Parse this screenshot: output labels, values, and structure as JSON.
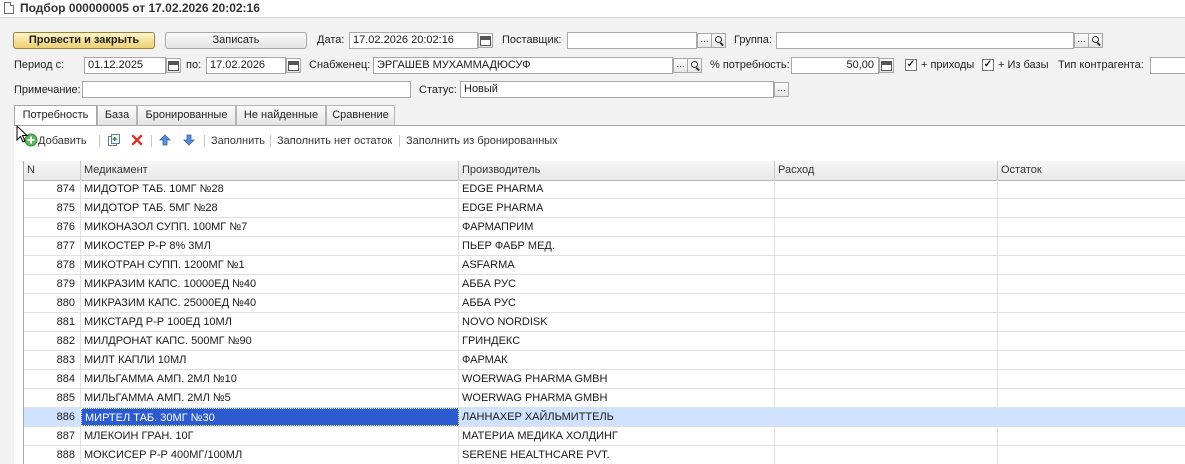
{
  "window": {
    "title": "Подбор 000000005 от 17.02.2026 20:02:16"
  },
  "buttons": {
    "post_close": "Провести и закрыть",
    "save": "Записать"
  },
  "header": {
    "date_label": "Дата:",
    "date_value": "17.02.2026 20:02:16",
    "supplier_label": "Поставщик:",
    "supplier_value": "",
    "group_label": "Группа:",
    "group_value": "",
    "period_label": "Период с:",
    "period_from": "01.12.2025",
    "period_to_label": "по:",
    "period_to": "17.02.2026",
    "procurer_label": "Снабженец:",
    "procurer_value": "ЭРГАШЕВ МУХАММАДЮСУФ",
    "need_pct_label": "% потребность:",
    "need_pct_value": "50,00",
    "incoming_label": "+ приходы",
    "incoming_checked": true,
    "from_base_label": "+ Из базы",
    "from_base_checked": true,
    "contractor_type_label": "Тип контрагента:",
    "note_label": "Примечание:",
    "note_value": "",
    "status_label": "Статус:",
    "status_value": "Новый"
  },
  "tabs": [
    "Потребность",
    "База",
    "Бронированные",
    "Не найденные",
    "Сравнение"
  ],
  "toolbar": {
    "add": "Добавить",
    "fill": "Заполнить",
    "fill_no_stock": "Заполнить нет остаток",
    "fill_from_reserved": "Заполнить из бронированных"
  },
  "table": {
    "columns": [
      "N",
      "Медикамент",
      "Производитель",
      "Расход",
      "Остаток"
    ],
    "rows": [
      {
        "n": "874",
        "drug": "МИДОТОР ТАБ. 10МГ №28",
        "maker": "EDGE PHARMA",
        "usage": "",
        "stock": ""
      },
      {
        "n": "875",
        "drug": "МИДОТОР ТАБ. 5МГ №28",
        "maker": "EDGE PHARMA",
        "usage": "",
        "stock": ""
      },
      {
        "n": "876",
        "drug": "МИКОНАЗОЛ СУПП. 100МГ №7",
        "maker": "ФАРМАПРИМ",
        "usage": "",
        "stock": ""
      },
      {
        "n": "877",
        "drug": "МИКОСТЕР Р-Р 8% 3МЛ",
        "maker": "ПЬЕР ФАБР МЕД.",
        "usage": "",
        "stock": ""
      },
      {
        "n": "878",
        "drug": "МИКОТРАН СУПП. 1200МГ №1",
        "maker": "ASFARMA",
        "usage": "",
        "stock": ""
      },
      {
        "n": "879",
        "drug": "МИКРАЗИМ КАПС. 10000ЕД №40",
        "maker": "АББА РУС",
        "usage": "",
        "stock": ""
      },
      {
        "n": "880",
        "drug": "МИКРАЗИМ КАПС. 25000ЕД №40",
        "maker": "АББА РУС",
        "usage": "",
        "stock": ""
      },
      {
        "n": "881",
        "drug": "МИКСТАРД Р-Р 100ЕД 10МЛ",
        "maker": "NOVO NORDISK",
        "usage": "",
        "stock": ""
      },
      {
        "n": "882",
        "drug": "МИЛДРОНАТ КАПС. 500МГ №90",
        "maker": "ГРИНДЕКС",
        "usage": "",
        "stock": ""
      },
      {
        "n": "883",
        "drug": "МИЛТ КАПЛИ 10МЛ",
        "maker": "ФАРМАК",
        "usage": "",
        "stock": ""
      },
      {
        "n": "884",
        "drug": "МИЛЬГАММА АМП. 2МЛ №10",
        "maker": "WOERWAG PHARMA GMBH",
        "usage": "",
        "stock": ""
      },
      {
        "n": "885",
        "drug": "МИЛЬГАММА АМП. 2МЛ №5",
        "maker": "WOERWAG PHARMA GMBH",
        "usage": "",
        "stock": ""
      },
      {
        "n": "886",
        "drug": "МИРТЕЛ ТАБ. 30МГ №30",
        "maker": "ЛАННАХЕР ХАЙЛЬМИТТЕЛЬ",
        "usage": "",
        "stock": "",
        "selected": true
      },
      {
        "n": "887",
        "drug": "МЛЕКОИН ГРАН. 10Г",
        "maker": "МАТЕРИА МЕДИКА ХОЛДИНГ",
        "usage": "",
        "stock": ""
      },
      {
        "n": "888",
        "drug": "МОКСИСЕР Р-Р 400МГ/100МЛ",
        "maker": "SERENE HEALTHCARE PVT.",
        "usage": "",
        "stock": ""
      }
    ]
  },
  "colors": {
    "selected_row": "#cfe2ff",
    "current_cell": "#2c5bcf",
    "primary_button": "#eccf72"
  }
}
